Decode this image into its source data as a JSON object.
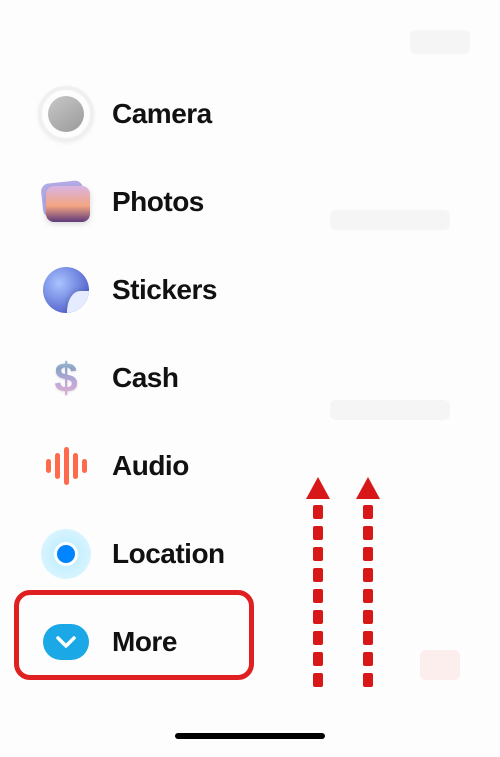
{
  "menu": {
    "items": [
      {
        "id": "camera",
        "label": "Camera",
        "icon": "camera-icon"
      },
      {
        "id": "photos",
        "label": "Photos",
        "icon": "photos-icon"
      },
      {
        "id": "stickers",
        "label": "Stickers",
        "icon": "stickers-icon"
      },
      {
        "id": "cash",
        "label": "Cash",
        "icon": "cash-icon",
        "symbol": "$"
      },
      {
        "id": "audio",
        "label": "Audio",
        "icon": "audio-icon"
      },
      {
        "id": "location",
        "label": "Location",
        "icon": "location-icon"
      },
      {
        "id": "more",
        "label": "More",
        "icon": "more-icon"
      }
    ]
  },
  "annotations": {
    "highlight_target": "more",
    "highlight_color": "#e02020",
    "arrows": {
      "count": 2,
      "direction": "up",
      "style": "dashed",
      "color": "#d81818"
    }
  }
}
